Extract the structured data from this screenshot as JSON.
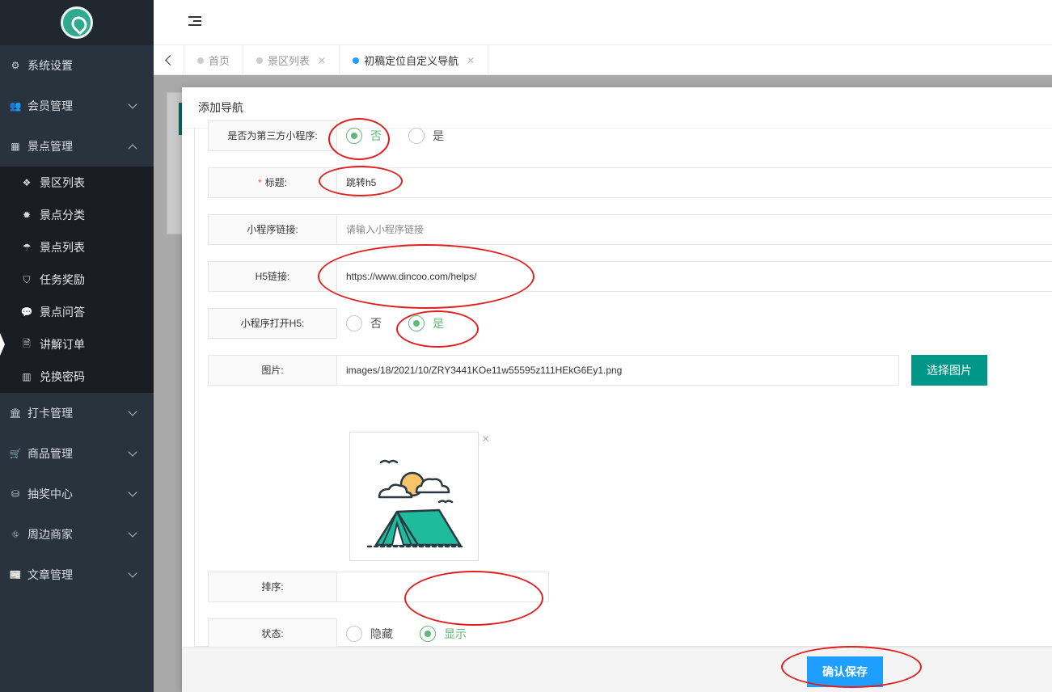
{
  "sidebar": {
    "items": [
      {
        "label": "系统设置",
        "icon": "gears-icon",
        "arrow": "none"
      },
      {
        "label": "会员管理",
        "icon": "users-icon",
        "arrow": "down"
      },
      {
        "label": "景点管理",
        "icon": "grid-icon",
        "arrow": "up"
      }
    ],
    "submenu": [
      {
        "label": "景区列表",
        "icon": "cubes-icon"
      },
      {
        "label": "景点分类",
        "icon": "gear-icon"
      },
      {
        "label": "景点列表",
        "icon": "umbrella-icon"
      },
      {
        "label": "任务奖励",
        "icon": "shield-icon"
      },
      {
        "label": "景点问答",
        "icon": "chat-icon"
      },
      {
        "label": "讲解订单",
        "icon": "audio-file-icon"
      },
      {
        "label": "兑换密码",
        "icon": "barcode-icon"
      }
    ],
    "items_after": [
      {
        "label": "打卡管理",
        "icon": "bank-icon"
      },
      {
        "label": "商品管理",
        "icon": "cart-icon"
      },
      {
        "label": "抽奖中心",
        "icon": "database-icon"
      },
      {
        "label": "周边商家",
        "icon": "sitemap-icon"
      },
      {
        "label": "文章管理",
        "icon": "newspaper-icon"
      }
    ]
  },
  "tabs": [
    {
      "label": "首页",
      "closable": false,
      "current": false
    },
    {
      "label": "景区列表",
      "closable": true,
      "current": false
    },
    {
      "label": "初稿定位自定义导航",
      "closable": true,
      "current": true
    }
  ],
  "modal": {
    "title": "添加导航",
    "third_party": {
      "label": "是否为第三方小程序:",
      "no": "否",
      "yes": "是",
      "selected": "否"
    },
    "title_field": {
      "required_mark": "*",
      "label": "标题:",
      "value": "跳转h5"
    },
    "mini_link": {
      "label": "小程序链接:",
      "placeholder": "请输入小程序链接",
      "value": ""
    },
    "h5_link": {
      "label": "H5链接:",
      "value": "https://www.dincoo.com/helps/"
    },
    "open_h5": {
      "label": "小程序打开H5:",
      "no": "否",
      "yes": "是",
      "selected": "是"
    },
    "image": {
      "label": "图片:",
      "value": "images/18/2021/10/ZRY3441KOe11w55595z111HEkG6Ey1.png",
      "button": "选择图片",
      "close": "×"
    },
    "sort": {
      "label": "排序:",
      "value": ""
    },
    "status": {
      "label": "状态:",
      "hide": "隐藏",
      "show": "显示",
      "selected": "显示"
    },
    "save_button": "确认保存"
  },
  "colors": {
    "sidebar_bg": "#28333e",
    "submenu_bg": "#1a1e22",
    "accent_blue": "#1e9fff",
    "accent_green": "#5fb878",
    "teal_button": "#009688",
    "annotation_red": "#e02020"
  }
}
